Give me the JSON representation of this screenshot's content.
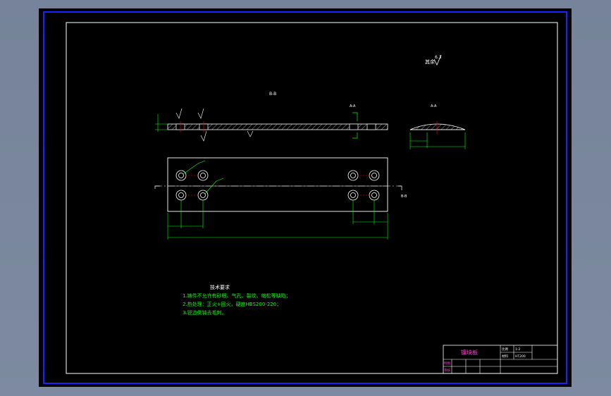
{
  "drawing": {
    "roughness_note": "其余",
    "roughness_value": "6.3",
    "section_label_bb": "B-B",
    "section_label_aa_side": "A-A",
    "section_label_aa_detail": "A-A",
    "section_right_marker": "B-B"
  },
  "technical_requirements": {
    "title": "技术要求",
    "lines": [
      "1.铸件不允许有砂眼、气孔、裂纹、缩松等缺陷；",
      "2.热处理：正火+回火，硬度HBS200-220；",
      "3.锐边倒钝去毛刺。"
    ]
  },
  "title_block": {
    "part_name": "镶块板",
    "right_top_1": "比例",
    "right_top_2": "1:2",
    "right_mid_1": "材料",
    "right_mid_2": "HT200",
    "left_label_1": "制图",
    "left_label_2": "审核"
  },
  "colors": {
    "background": "#000000",
    "frame": "#0000ff",
    "lines": "#ffffff",
    "dimensions": "#00ff00",
    "centerlines": "#ff0000",
    "text_accent": "#ffff00"
  }
}
